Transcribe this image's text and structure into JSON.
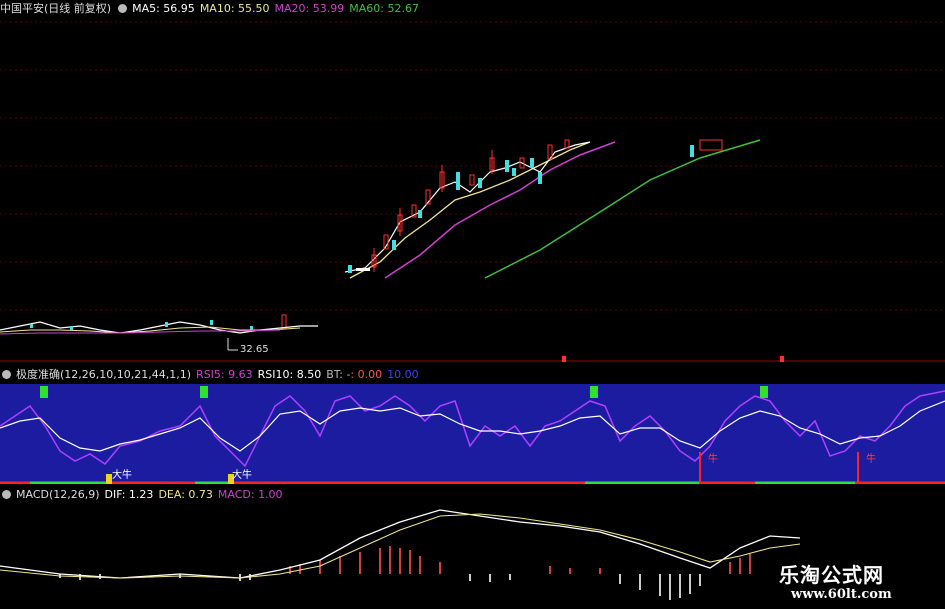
{
  "price_pane": {
    "title": "中国平安(日线 前复权)",
    "ma5": "MA5: 56.95",
    "ma10": "MA10: 55.50",
    "ma20": "MA20: 53.99",
    "ma60": "MA60: 52.67",
    "low_label": "32.65",
    "colors": {
      "ma5": "#ffffff",
      "ma10": "#f0e68c",
      "ma20": "#d040d0",
      "ma60": "#40c040",
      "up": "#ff3030",
      "down": "#40e0e0"
    }
  },
  "rsi_pane": {
    "title": "极度准确(12,26,10,10,21,44,1,1)",
    "rsi5": "RSI5: 9.63",
    "rsi10": "RSI10: 8.50",
    "bt": "BT: -",
    "v1": ": 0.00",
    "v2": "10.00",
    "signals": [
      "大牛",
      "大牛",
      "牛",
      "牛"
    ],
    "background": "#1c1ca0"
  },
  "macd_pane": {
    "title": "MACD(12,26,9)",
    "dif": "DIF: 1.23",
    "dea": "DEA: 0.73",
    "macd": "MACD: 1.00"
  },
  "watermark": {
    "title": "乐淘公式网",
    "url": "www.60lt.com"
  }
}
